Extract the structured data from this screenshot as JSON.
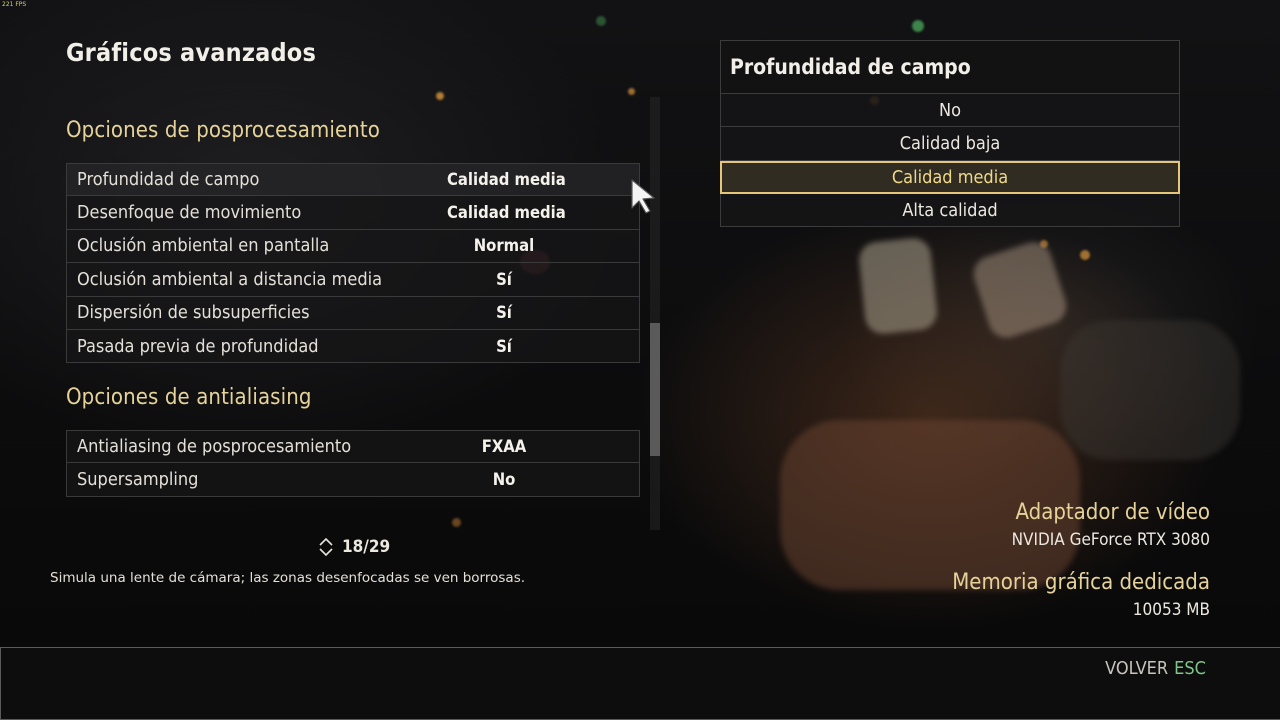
{
  "overlay": {
    "fps": "221 FPS"
  },
  "page": {
    "title": "Gráficos avanzados"
  },
  "sections": [
    {
      "title": "Opciones de posprocesamiento",
      "rows": [
        {
          "label": "Profundidad de campo",
          "value": "Calidad media"
        },
        {
          "label": "Desenfoque de movimiento",
          "value": "Calidad media"
        },
        {
          "label": "Oclusión ambiental en pantalla",
          "value": "Normal"
        },
        {
          "label": "Oclusión ambiental a distancia media",
          "value": "Sí"
        },
        {
          "label": "Dispersión de subsuperficies",
          "value": "Sí"
        },
        {
          "label": "Pasada previa de profundidad",
          "value": "Sí"
        }
      ]
    },
    {
      "title": "Opciones de antialiasing",
      "rows": [
        {
          "label": "Antialiasing de posprocesamiento",
          "value": "FXAA"
        },
        {
          "label": "Supersampling",
          "value": "No"
        }
      ]
    }
  ],
  "pager": {
    "text": "18/29",
    "icon": "up-down-chevron-icon"
  },
  "description": "Simula una lente de cámara; las zonas desenfocadas se ven borrosas.",
  "dropdown": {
    "title": "Profundidad de campo",
    "options": [
      "No",
      "Calidad baja",
      "Calidad media",
      "Alta calidad"
    ],
    "selected_index": 2
  },
  "info": {
    "adapter_label": "Adaptador de vídeo",
    "adapter_value": "NVIDIA GeForce RTX 3080",
    "memory_label": "Memoria gráfica dedicada",
    "memory_value": "10053 MB"
  },
  "footer": {
    "back_label": "VOLVER",
    "back_key": "ESC"
  },
  "colors": {
    "accent_gold": "#e6d39a",
    "selected_border": "#e5c77c",
    "key_green": "#7fc48a"
  }
}
